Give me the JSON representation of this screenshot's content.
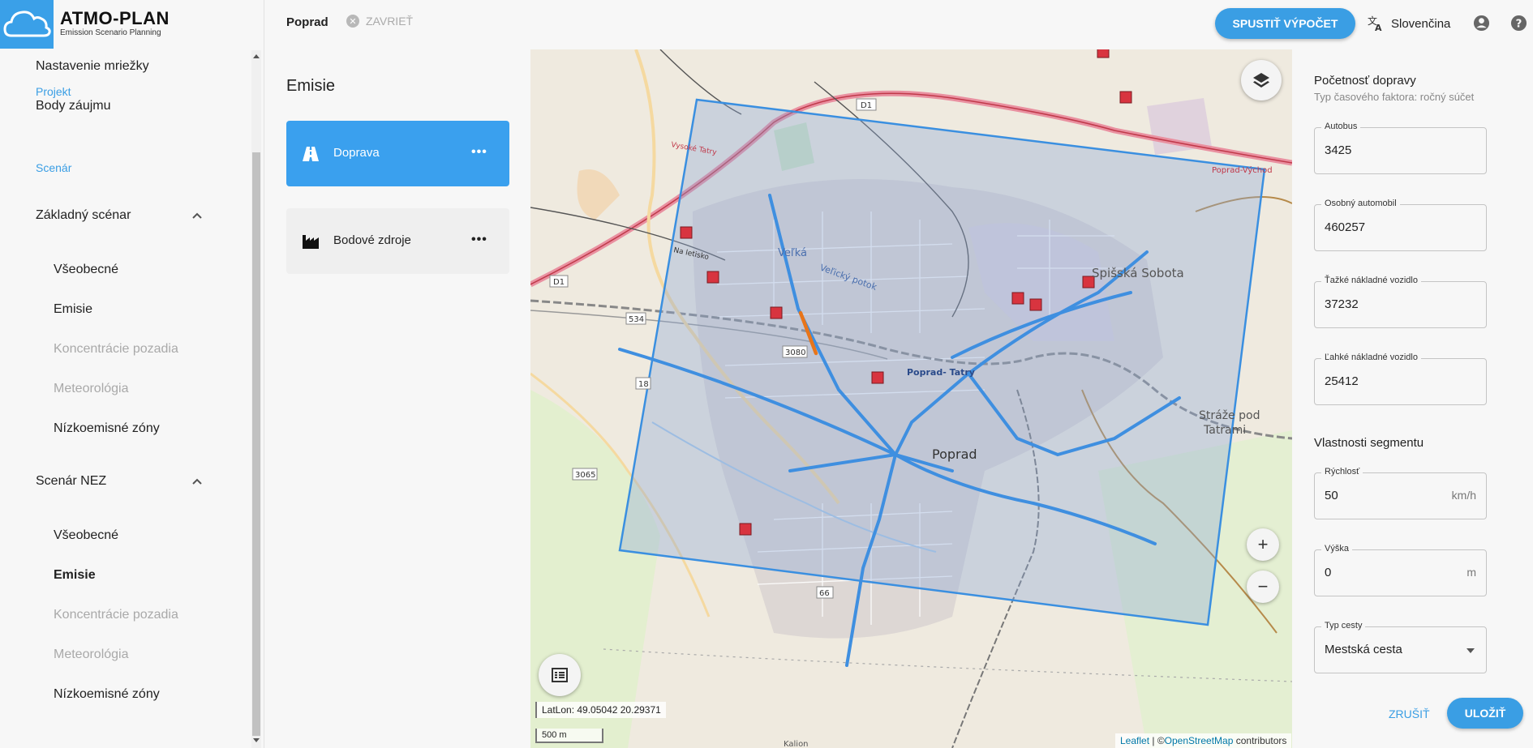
{
  "app": {
    "logo_title": "ATMO-PLAN",
    "logo_subtitle": "Emission Scenario Planning"
  },
  "sidebar": {
    "grid_settings": "Nastavenie mriežky",
    "project_label": "Projekt",
    "points_of_interest": "Body záujmu",
    "scenario_label": "Scenár",
    "scenarios": [
      {
        "name": "Základný scénar",
        "items": [
          "Všeobecné",
          "Emisie",
          "Koncentrácie pozadia",
          "Meteorológia",
          "Nízkoemisné zóny"
        ]
      },
      {
        "name": "Scenár NEZ",
        "items": [
          "Všeobecné",
          "Emisie",
          "Koncentrácie pozadia",
          "Meteorológia",
          "Nízkoemisné zóny"
        ]
      }
    ]
  },
  "topbar": {
    "tab_title": "Poprad",
    "close_label": "ZAVRIEŤ",
    "run_button": "SPUSTIŤ VÝPOČET",
    "language": "Slovenčina"
  },
  "emissions": {
    "title": "Emisie",
    "cards": [
      {
        "label": "Doprava",
        "icon": "road-icon",
        "selected": true
      },
      {
        "label": "Bodové zdroje",
        "icon": "factory-icon",
        "selected": false
      }
    ]
  },
  "map": {
    "latlon": "LatLon: 49.05042 20.29371",
    "scale": "500 m",
    "attribution_leaflet": "Leaflet",
    "attribution_sep": " | ©",
    "attribution_osm": "OpenStreetMap",
    "attribution_tail": " contributors",
    "zoom_in": "+",
    "zoom_out": "−",
    "labels": {
      "poprad": "Poprad",
      "poprad_tatry": "Poprad-\nTatry",
      "spisska_sobota": "Spišská Sobota",
      "straze": "Stráže pod",
      "tatrami": "Tatrami",
      "velka": "Veľká",
      "velicky_potok": "Veľický potok",
      "vychod": "Poprad-Východ",
      "d1": "D1",
      "d1b": "D1",
      "r534": "534",
      "r3065": "3065",
      "r3080": "3080",
      "r66": "66",
      "r18": "18",
      "na_letisko": "Na letisko",
      "kalion": "Kalion",
      "vysoke": "Vysoké Tatry"
    }
  },
  "traffic": {
    "heading": "Početnosť dopravy",
    "subheading": "Typ časového faktora: ročný súčet",
    "fields": [
      {
        "label": "Autobus",
        "value": "3425"
      },
      {
        "label": "Osobný automobil",
        "value": "460257"
      },
      {
        "label": "Ťažké nákladné vozidlo",
        "value": "37232"
      },
      {
        "label": "Ľahké nákladné vozidlo",
        "value": "25412"
      }
    ]
  },
  "segment": {
    "heading": "Vlastnosti segmentu",
    "speed": {
      "label": "Rýchlosť",
      "value": "50",
      "unit": "km/h"
    },
    "height": {
      "label": "Výška",
      "value": "0",
      "unit": "m"
    },
    "road_type": {
      "label": "Typ cesty",
      "value": "Mestská cesta"
    }
  },
  "actions": {
    "cancel": "ZRUŠIŤ",
    "save": "ULOŽIŤ"
  },
  "colors": {
    "accent": "#3a9ee4",
    "poi_marker": "#d8343f",
    "selected_segment": "#e8751a"
  }
}
